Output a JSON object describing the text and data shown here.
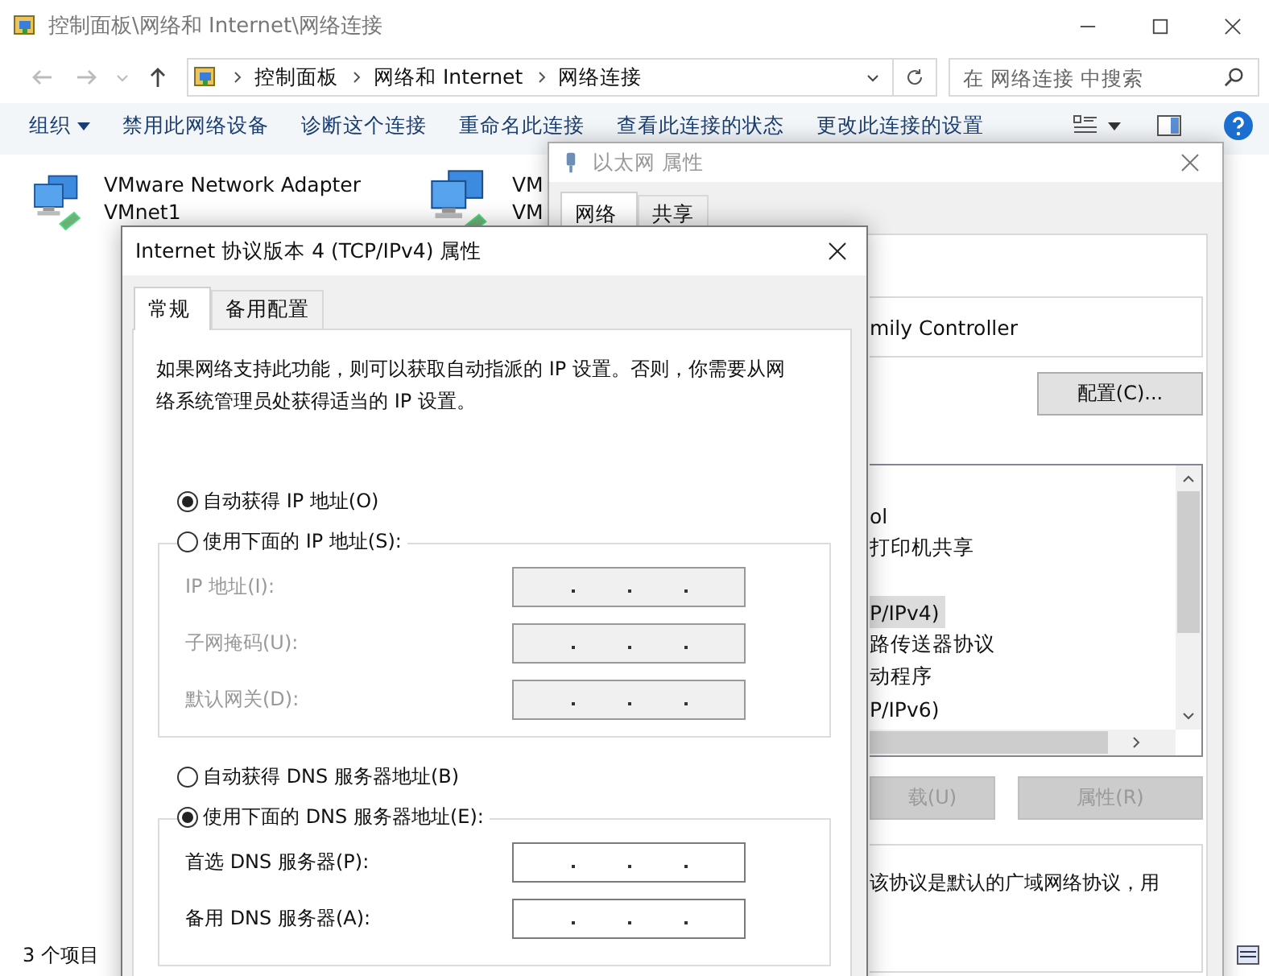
{
  "explorer": {
    "title": "控制面板\\网络和 Internet\\网络连接",
    "breadcrumb": [
      "控制面板",
      "网络和 Internet",
      "网络连接"
    ],
    "search": {
      "placeholder": "在 网络连接 中搜索"
    },
    "toolbar": [
      {
        "label": "组织",
        "dropdown": true
      },
      {
        "label": "禁用此网络设备",
        "dropdown": false
      },
      {
        "label": "诊断这个连接",
        "dropdown": false
      },
      {
        "label": "重命名此连接",
        "dropdown": false
      },
      {
        "label": "查看此连接的状态",
        "dropdown": false
      },
      {
        "label": "更改此连接的设置",
        "dropdown": false
      }
    ],
    "items": [
      {
        "name": "VMware Network Adapter",
        "subtitle": "VMnet1"
      },
      {
        "name": "VM",
        "subtitle": "VM"
      }
    ],
    "status_bar": "3 个项目"
  },
  "ethernet_dialog": {
    "title": "以太网 属性",
    "tabs": [
      {
        "label": "网络",
        "selected": true
      },
      {
        "label": "共享",
        "selected": false
      }
    ],
    "adapter": "mily Controller",
    "configure_button": "配置(C)...",
    "components": [
      {
        "kind": "item",
        "label": "ol",
        "selected": false
      },
      {
        "kind": "item",
        "label": "打印机共享",
        "selected": false
      },
      {
        "kind": "blank"
      },
      {
        "kind": "item",
        "label": "P/IPv4)",
        "selected": true
      },
      {
        "kind": "item",
        "label": "路传送器协议",
        "selected": false
      },
      {
        "kind": "item",
        "label": "动程序",
        "selected": false
      },
      {
        "kind": "item",
        "label": "P/IPv6)",
        "selected": false
      }
    ],
    "buttons": [
      {
        "label": "载(U)",
        "disabled": true
      },
      {
        "label": "属性(R)",
        "disabled": true
      }
    ],
    "description": "该协议是默认的广域网络协议，用"
  },
  "ipv4_dialog": {
    "title": "Internet 协议版本 4 (TCP/IPv4) 属性",
    "tabs": [
      {
        "label": "常规",
        "selected": true
      },
      {
        "label": "备用配置",
        "selected": false
      }
    ],
    "intro": "如果网络支持此功能，则可以获取自动指派的 IP 设置。否则，你需要从网络系统管理员处获得适当的 IP 设置。",
    "ip_mode": [
      {
        "label": "自动获得 IP 地址(O)",
        "selected": true
      },
      {
        "label": "使用下面的 IP 地址(S):",
        "selected": false
      }
    ],
    "ip_fields": [
      {
        "label": "IP 地址(I):",
        "disabled": true
      },
      {
        "label": "子网掩码(U):",
        "disabled": true
      },
      {
        "label": "默认网关(D):",
        "disabled": true
      }
    ],
    "dns_mode": [
      {
        "label": "自动获得 DNS 服务器地址(B)",
        "selected": false
      },
      {
        "label": "使用下面的 DNS 服务器地址(E):",
        "selected": true
      }
    ],
    "dns_fields": [
      {
        "label": "首选 DNS 服务器(P):",
        "disabled": false
      },
      {
        "label": "备用 DNS 服务器(A):",
        "disabled": false
      }
    ]
  }
}
